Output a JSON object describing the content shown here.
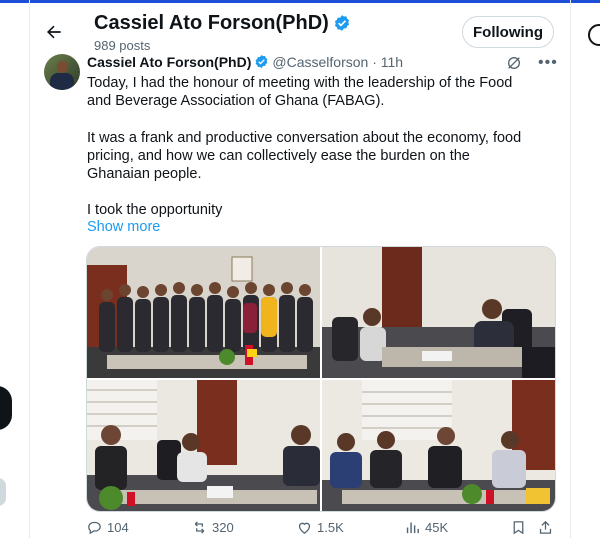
{
  "header": {
    "name": "Cassiel Ato Forson(PhD)",
    "post_count": "989 posts",
    "follow_label": "Following"
  },
  "post": {
    "name": "Cassiel Ato Forson(PhD)",
    "handle": "@Casselforson",
    "time": "· 11h",
    "paragraphs": [
      "Today, I had the honour of meeting with the leadership of the Food and Beverage Association of Ghana (FABAG).",
      "It was a frank and productive conversation about the economy, food pricing, and how we can collectively ease the burden on the Ghanaian people.",
      "I took the opportunity"
    ],
    "show_more": "Show more"
  },
  "actions": {
    "replies": "104",
    "reposts": "320",
    "likes": "1.5K",
    "views": "45K"
  },
  "colors": {
    "accent": "#1d9bf0",
    "text": "#0f1419",
    "muted": "#536471",
    "repost": "#00ba7c"
  },
  "icons": [
    "back-arrow-icon",
    "verified-icon",
    "grok-icon",
    "more-icon",
    "reply-icon",
    "repost-icon",
    "like-icon",
    "views-icon",
    "bookmark-icon",
    "share-icon"
  ]
}
